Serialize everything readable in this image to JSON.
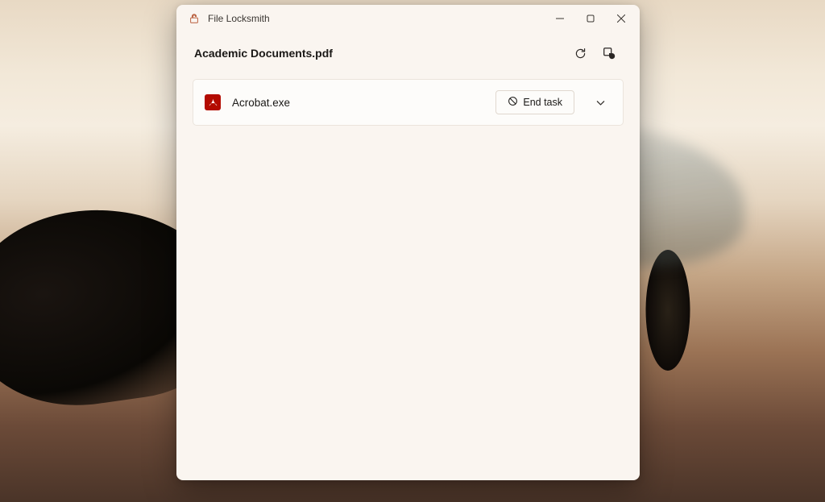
{
  "app": {
    "title": "File Locksmith",
    "icon": "lock-open-icon"
  },
  "file": {
    "name": "Academic Documents.pdf"
  },
  "actions": {
    "refresh": "refresh-icon",
    "restart_admin": "admin-restart-icon"
  },
  "processes": [
    {
      "icon": "acrobat-icon",
      "name": "Acrobat.exe",
      "end_task_label": "End task"
    }
  ],
  "window_controls": {
    "minimize": "minimize-icon",
    "maximize": "maximize-icon",
    "close": "close-icon"
  }
}
